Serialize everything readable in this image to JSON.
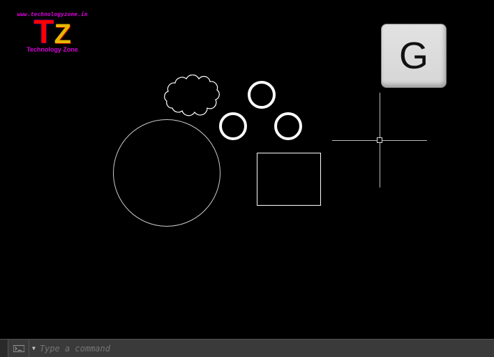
{
  "logo": {
    "url_text": "www.technologyzone.in",
    "letter1": "T",
    "letter2": "Z",
    "tagline": "Technology Zone"
  },
  "key": {
    "label": "G"
  },
  "commandbar": {
    "placeholder": "Type a command"
  }
}
